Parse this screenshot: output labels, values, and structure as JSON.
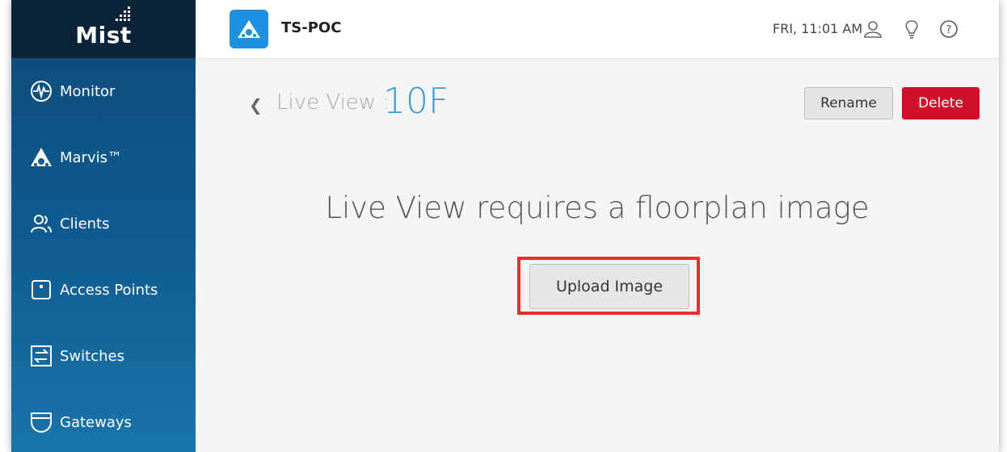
{
  "app": {
    "logo_text": "Mist"
  },
  "sidebar": {
    "items": [
      {
        "label": "Monitor",
        "icon": "monitor-icon"
      },
      {
        "label": "Marvis™",
        "icon": "marvis-icon"
      },
      {
        "label": "Clients",
        "icon": "clients-icon"
      },
      {
        "label": "Access Points",
        "icon": "access-point-icon"
      },
      {
        "label": "Switches",
        "icon": "switch-icon"
      },
      {
        "label": "Gateways",
        "icon": "gateway-icon"
      }
    ]
  },
  "header": {
    "org_name": "TS-POC",
    "datetime": "FRI, 11:01 AM",
    "icons": [
      "user-icon",
      "lightbulb-icon",
      "help-icon"
    ]
  },
  "page": {
    "title_label": "Live View :",
    "title_value": "10F",
    "rename_label": "Rename",
    "delete_label": "Delete",
    "message": "Live View requires a floorplan image",
    "upload_label": "Upload Image"
  },
  "colors": {
    "sidebar_top": "#0b2338",
    "sidebar": "#0f5c91",
    "accent_blue": "#3a9ad9",
    "delete_red": "#d0112b",
    "highlight_red": "#e0312a"
  }
}
